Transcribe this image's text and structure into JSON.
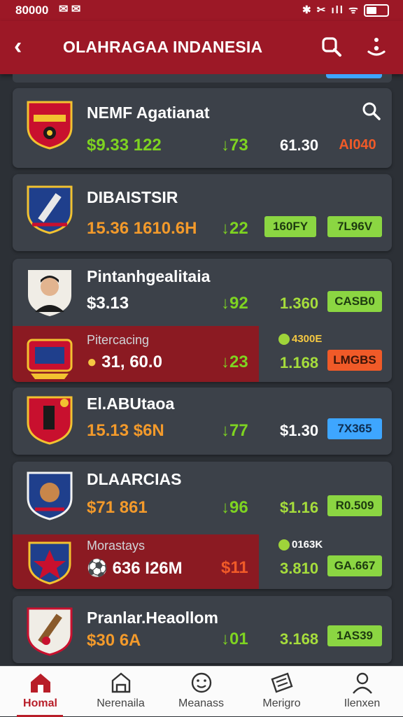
{
  "status_bar": {
    "time": "80000",
    "left_icons": "✉ ✉",
    "right_icons": "✱ ✂ ıll ᯤ"
  },
  "header": {
    "title": "OLAHRAGAA INDANESIA",
    "back_icon": "back-arrow-icon",
    "search_icon": "search-icon",
    "menu_icon": "more-icon"
  },
  "teams": [
    {
      "name": "NEMF Agatianat",
      "price": "$9.33 122",
      "change": "↓73",
      "value": "61.30",
      "badge": "AI040",
      "search_icon": "magnifier-icon"
    },
    {
      "name": "DIBAISTSIR",
      "price": "15.36 1610.6H",
      "change": "↓22",
      "value_badge": "160FY",
      "badge": "7L96V"
    },
    {
      "name": "Pintanhgealitaia",
      "price": "$3.13",
      "change": "↓92",
      "value": "1.360",
      "badge": "CASB0"
    },
    {
      "sub": "Pitercacing",
      "price": "31, 60.0",
      "change": "↓23",
      "value": "1.168",
      "mini": "4300E",
      "badge": "LMGBS"
    },
    {
      "name": "El.ABUtaoa",
      "price": "15.13 $6N",
      "change": "↓77",
      "value": "$1.30",
      "badge": "7X365"
    },
    {
      "name": "DLAARCIAS",
      "price": "$71 861",
      "change": "↓96",
      "value": "$1.16",
      "badge": "R0.509"
    },
    {
      "sub": "Morastays",
      "price": "636 I26M",
      "change": "$11",
      "value": "3.810",
      "mini": "0163K",
      "badge": "GA.667"
    },
    {
      "name": "Pranlar.Heaollom",
      "price": "$30 6A",
      "change": "↓01",
      "value": "3.168",
      "badge": "1AS39"
    }
  ],
  "nav": [
    {
      "label": "Homal",
      "icon": "home-icon",
      "active": true
    },
    {
      "label": "Nerenaila",
      "icon": "stadium-icon"
    },
    {
      "label": "Meanass",
      "icon": "ball-face-icon"
    },
    {
      "label": "Merigro",
      "icon": "ticket-icon"
    },
    {
      "label": "Ilenxen",
      "icon": "profile-icon"
    }
  ],
  "colors": {
    "header": "#9c1826",
    "card": "#3c4149",
    "highlight": "#8b1a22",
    "green": "#7ed321",
    "orange": "#f39a2b",
    "lime_badge": "#8bd642",
    "blue_badge": "#3ea6ff"
  }
}
